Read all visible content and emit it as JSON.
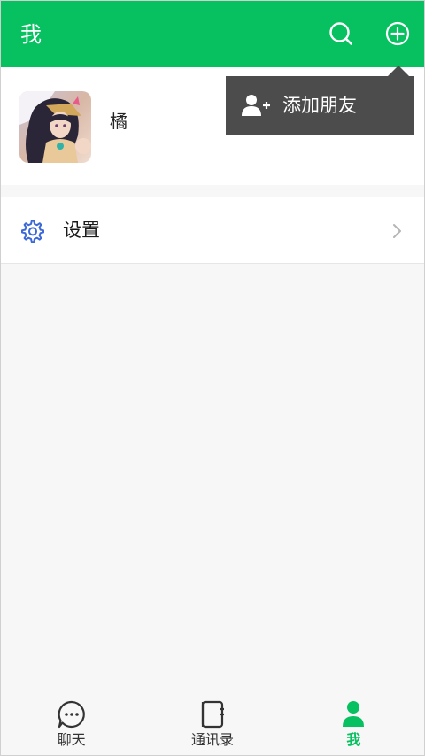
{
  "header": {
    "title": "我",
    "search_icon": "search-icon",
    "add_icon": "plus-circle-icon",
    "background": "#07c160"
  },
  "profile": {
    "name": "橘",
    "avatar_icon": "avatar"
  },
  "settings": {
    "label": "设置",
    "icon": "gear-icon",
    "icon_color": "#3d68d8"
  },
  "popup_menu": {
    "items": [
      {
        "label": "添加朋友",
        "icon": "add-user-icon"
      }
    ]
  },
  "tabbar": {
    "tabs": [
      {
        "label": "聊天",
        "icon": "chat-icon",
        "active": false
      },
      {
        "label": "通讯录",
        "icon": "contacts-icon",
        "active": false
      },
      {
        "label": "我",
        "icon": "person-icon",
        "active": true
      }
    ],
    "active_color": "#07c160"
  }
}
